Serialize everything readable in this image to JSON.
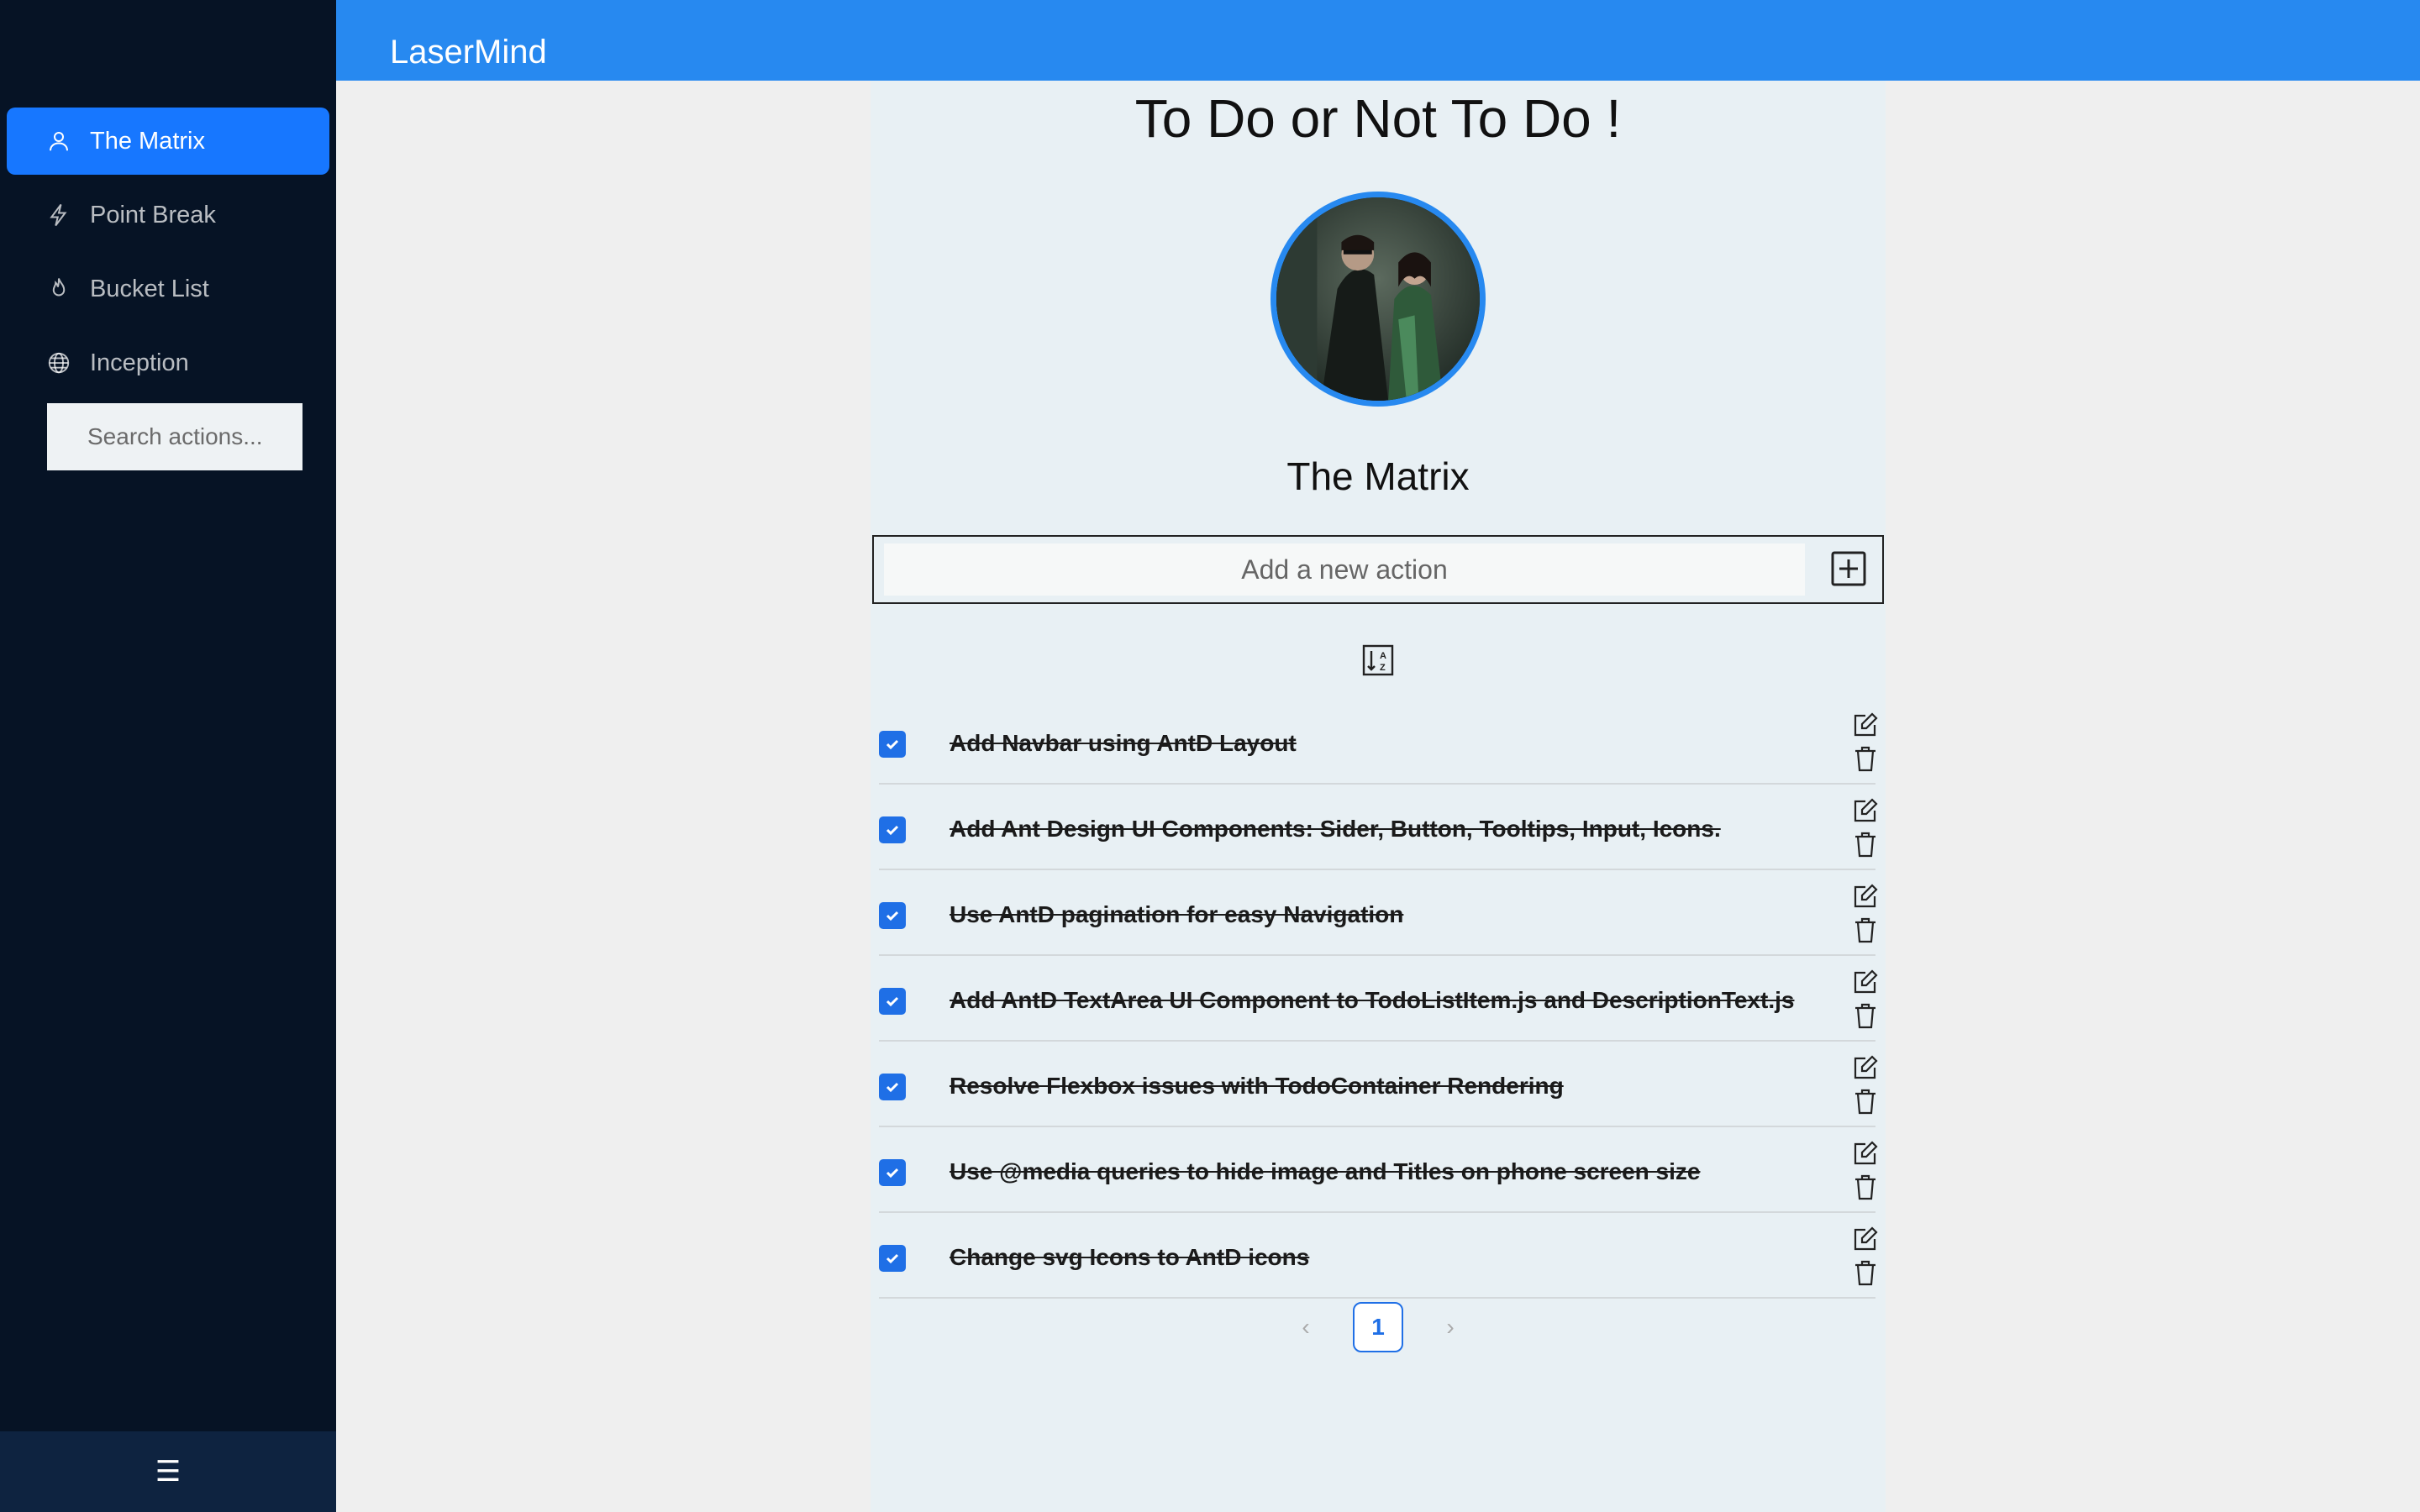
{
  "app": {
    "brand": "LaserMind"
  },
  "sidebar": {
    "items": [
      {
        "label": "The Matrix",
        "icon": "user-icon",
        "active": true
      },
      {
        "label": "Point Break",
        "icon": "thunderbolt-icon",
        "active": false
      },
      {
        "label": "Bucket List",
        "icon": "fire-icon",
        "active": false
      },
      {
        "label": "Inception",
        "icon": "global-icon",
        "active": false
      }
    ],
    "search_placeholder": "Search actions...",
    "trigger_glyph": "☰"
  },
  "main": {
    "title": "To Do or Not To Do !",
    "list_title": "The Matrix",
    "add_placeholder": "Add a new action",
    "todos": [
      {
        "text": "Add Navbar using AntD Layout",
        "done": true
      },
      {
        "text": "Add Ant Design UI Components: Sider, Button, Tooltips, Input, Icons.",
        "done": true
      },
      {
        "text": "Use AntD pagination for easy Navigation",
        "done": true
      },
      {
        "text": "Add AntD TextArea UI Component to TodoListItem.js and DescriptionText.js",
        "done": true
      },
      {
        "text": "Resolve Flexbox issues with TodoContainer Rendering",
        "done": true
      },
      {
        "text": "Use @media queries to hide image and Titles on phone screen size",
        "done": true
      },
      {
        "text": "Change svg Icons to AntD icons",
        "done": true
      }
    ],
    "pagination": {
      "current": "1",
      "prev": "‹",
      "next": "›"
    }
  },
  "colors": {
    "sider_bg": "#061325",
    "header_bg": "#2789f0",
    "accent": "#1777ff",
    "checkbox": "#1f6fe6"
  }
}
